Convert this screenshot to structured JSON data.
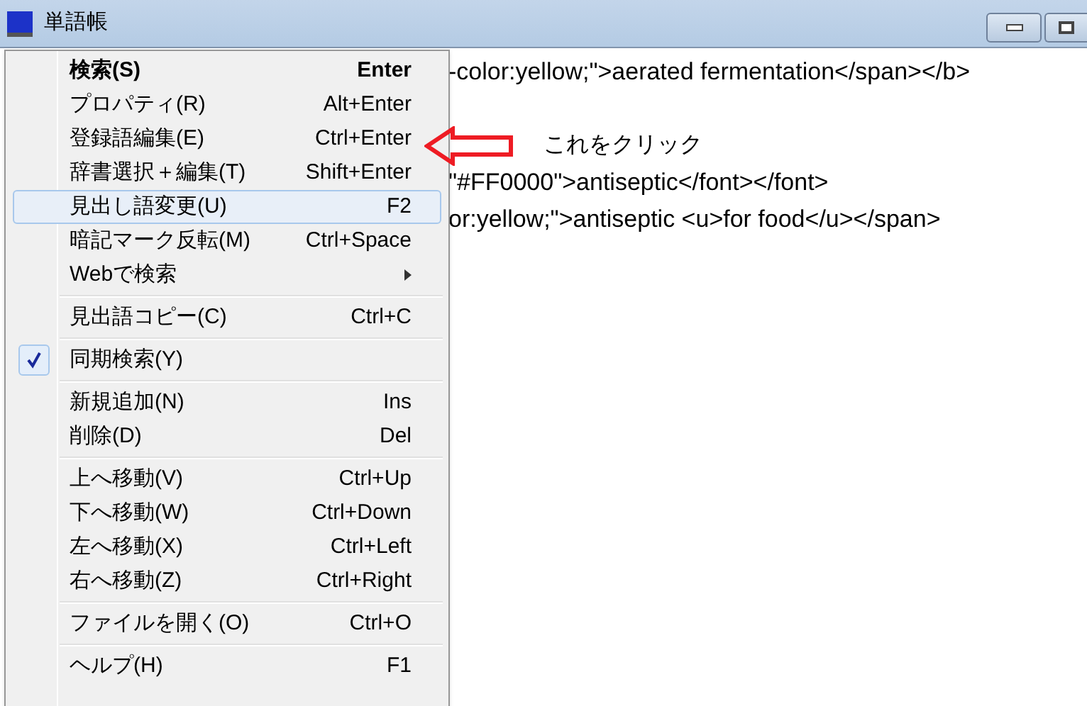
{
  "window": {
    "title": "単語帳"
  },
  "document": {
    "lines": [
      "-color:yellow;\">aerated fermentation</span></b>",
      "\"#FF0000\">antiseptic</font></font>",
      "or:yellow;\">antiseptic <u>for food</u></span>"
    ],
    "annotation": "これをクリック"
  },
  "context_menu": {
    "groups": [
      [
        {
          "kind": "command",
          "label": "検索(S)",
          "shortcut": "Enter",
          "default": true,
          "selected": false,
          "checked": false
        },
        {
          "kind": "command",
          "label": "プロパティ(R)",
          "shortcut": "Alt+Enter",
          "default": false,
          "selected": false,
          "checked": false
        },
        {
          "kind": "command",
          "label": "登録語編集(E)",
          "shortcut": "Ctrl+Enter",
          "default": false,
          "selected": false,
          "checked": false
        },
        {
          "kind": "command",
          "label": "辞書選択＋編集(T)",
          "shortcut": "Shift+Enter",
          "default": false,
          "selected": false,
          "checked": false
        },
        {
          "kind": "command",
          "label": "見出し語変更(U)",
          "shortcut": "F2",
          "default": false,
          "selected": true,
          "checked": false
        },
        {
          "kind": "command",
          "label": "暗記マーク反転(M)",
          "shortcut": "Ctrl+Space",
          "default": false,
          "selected": false,
          "checked": false
        },
        {
          "kind": "submenu",
          "label": "Webで検索",
          "default": false,
          "selected": false,
          "checked": false
        }
      ],
      [
        {
          "kind": "command",
          "label": "見出語コピー(C)",
          "shortcut": "Ctrl+C",
          "default": false,
          "selected": false,
          "checked": false
        }
      ],
      [
        {
          "kind": "command",
          "label": "同期検索(Y)",
          "default": false,
          "selected": false,
          "checked": true
        }
      ],
      [
        {
          "kind": "command",
          "label": "新規追加(N)",
          "shortcut": "Ins",
          "default": false,
          "selected": false,
          "checked": false
        },
        {
          "kind": "command",
          "label": "削除(D)",
          "shortcut": "Del",
          "default": false,
          "selected": false,
          "checked": false
        }
      ],
      [
        {
          "kind": "command",
          "label": "上へ移動(V)",
          "shortcut": "Ctrl+Up",
          "default": false,
          "selected": false,
          "checked": false
        },
        {
          "kind": "command",
          "label": "下へ移動(W)",
          "shortcut": "Ctrl+Down",
          "default": false,
          "selected": false,
          "checked": false
        },
        {
          "kind": "command",
          "label": "左へ移動(X)",
          "shortcut": "Ctrl+Left",
          "default": false,
          "selected": false,
          "checked": false
        },
        {
          "kind": "command",
          "label": "右へ移動(Z)",
          "shortcut": "Ctrl+Right",
          "default": false,
          "selected": false,
          "checked": false
        }
      ],
      [
        {
          "kind": "command",
          "label": "ファイルを開く(O)",
          "shortcut": "Ctrl+O",
          "default": false,
          "selected": false,
          "checked": false
        }
      ],
      [
        {
          "kind": "command",
          "label": "ヘルプ(H)",
          "shortcut": "F1",
          "default": false,
          "selected": false,
          "checked": false
        }
      ]
    ]
  }
}
